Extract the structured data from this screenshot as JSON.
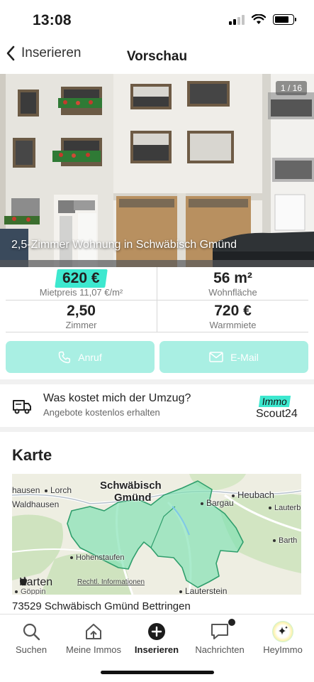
{
  "status_bar": {
    "time": "13:08"
  },
  "nav": {
    "back_label": "Inserieren",
    "title": "Vorschau"
  },
  "hero": {
    "photo_counter": "1 / 16",
    "title": "2,5-Zimmer Wohnung in Schwäbisch Gmünd"
  },
  "facts": {
    "rent_value": "620 €",
    "rent_label": "Mietpreis 11,07 €/m²",
    "area_value": "56 m²",
    "area_label": "Wohnfläche",
    "rooms_value": "2,50",
    "rooms_label": "Zimmer",
    "warm_value": "720 €",
    "warm_label": "Warmmiete"
  },
  "contact": {
    "call_label": "Anruf",
    "email_label": "E-Mail"
  },
  "moving": {
    "title": "Was kostet mich der Umzug?",
    "subtitle": "Angebote kostenlos erhalten",
    "brand_top": "Immo",
    "brand_bottom": "Scout24"
  },
  "map_section": {
    "title": "Karte",
    "labels": {
      "city_line1": "Schwäbisch",
      "city_line2": "Gmünd",
      "hausen": "hausen",
      "lorch": "Lorch",
      "waldhausen": "Waldhausen",
      "heubach": "Heubach",
      "bargau": "Bargau",
      "lauterb": "Lauterb",
      "barth": "Barth",
      "hohenstaufen": "Hohenstaufen",
      "lauterstein": "Lauterstein",
      "goeppingen": "Göppin"
    },
    "attribution": "Karten",
    "legal": "Rechtl. Informationen",
    "address": "73529 Schwäbisch Gmünd Bettringen"
  },
  "tabs": [
    {
      "label": "Suchen",
      "icon": "search-icon"
    },
    {
      "label": "Meine Immos",
      "icon": "house-icon"
    },
    {
      "label": "Inserieren",
      "icon": "plus-circle-icon"
    },
    {
      "label": "Nachrichten",
      "icon": "chat-icon"
    },
    {
      "label": "HeyImmo",
      "icon": "sparkle-icon"
    }
  ],
  "colors": {
    "accent": "#3de8cf",
    "button_bg": "#a9efe3",
    "map_area": "#7de0b0"
  }
}
